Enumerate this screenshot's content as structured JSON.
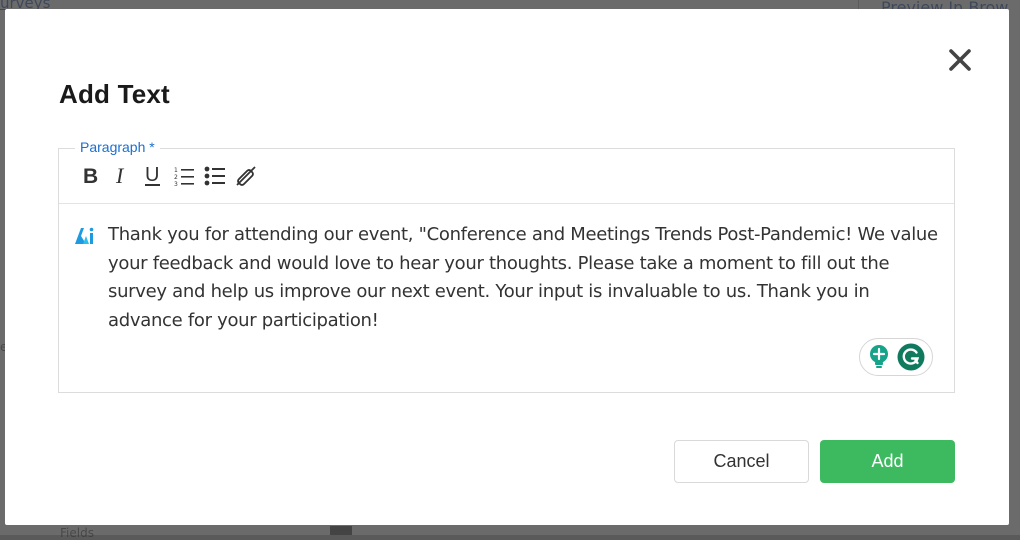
{
  "background": {
    "top_link": "urveys",
    "preview_link": "Preview In Brow",
    "side_text": "e",
    "bottom_text": "Fields"
  },
  "modal": {
    "title": "Add Text",
    "close_icon": "close-icon",
    "editor": {
      "label": "Paragraph *",
      "toolbar": [
        {
          "name": "bold",
          "icon": "bold-icon"
        },
        {
          "name": "italic",
          "icon": "italic-icon"
        },
        {
          "name": "underline",
          "icon": "underline-icon"
        },
        {
          "name": "ordered-list",
          "icon": "ordered-list-icon"
        },
        {
          "name": "bullet-list",
          "icon": "bullet-list-icon"
        },
        {
          "name": "clear-format",
          "icon": "clear-format-icon"
        }
      ],
      "content": "Thank you for attending our event, \"Conference and Meetings Trends Post-Pandemic! We value your feedback and would love to hear your thoughts. Please take a moment to fill out the survey and help us improve our next event. Your input is invaluable to us. Thank you in advance for your participation!"
    },
    "buttons": {
      "cancel": "Cancel",
      "add": "Add"
    },
    "colors": {
      "accent_green": "#3dba5f",
      "label_blue": "#1a6fd0",
      "grammarly_green": "#15a38a"
    }
  }
}
